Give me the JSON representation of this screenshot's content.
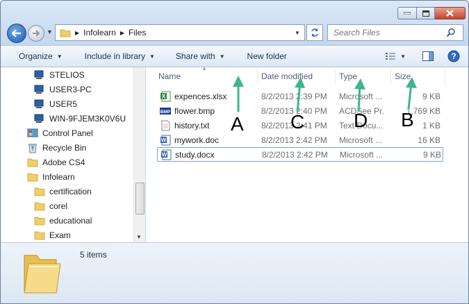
{
  "address": {
    "crumbs": [
      "Infolearn",
      "Files"
    ]
  },
  "search": {
    "placeholder": "Search Files"
  },
  "toolbar": {
    "organize": "Organize",
    "include_in_library": "Include in library",
    "share_with": "Share with",
    "new_folder": "New folder"
  },
  "sidebar": {
    "items": [
      {
        "label": "STELIOS",
        "icon": "computer-icon"
      },
      {
        "label": "USER3-PC",
        "icon": "computer-icon"
      },
      {
        "label": "USER5",
        "icon": "computer-icon"
      },
      {
        "label": "WIN-9FJEM3K0V6U",
        "icon": "computer-icon"
      },
      {
        "label": "Control Panel",
        "icon": "control-panel-icon"
      },
      {
        "label": "Recycle Bin",
        "icon": "recycle-bin-icon"
      },
      {
        "label": "Adobe CS4",
        "icon": "folder-icon"
      },
      {
        "label": "Infolearn",
        "icon": "folder-icon"
      },
      {
        "label": "certification",
        "icon": "folder-icon"
      },
      {
        "label": "corel",
        "icon": "folder-icon"
      },
      {
        "label": "educational",
        "icon": "folder-icon"
      },
      {
        "label": "Exam",
        "icon": "folder-icon"
      }
    ]
  },
  "columns": {
    "name": "Name",
    "date": "Date modified",
    "type": "Type",
    "size": "Size"
  },
  "files": [
    {
      "name": "expences.xlsx",
      "date": "8/2/2013 2:39 PM",
      "type": "Microsoft ...",
      "size": "9 KB",
      "icon": "excel-icon"
    },
    {
      "name": "flower.bmp",
      "date": "8/2/2013 2:40 PM",
      "type": "ACDSee Pr...",
      "size": "1,769 KB",
      "icon": "bmp-icon"
    },
    {
      "name": "history.txt",
      "date": "8/2/2013 2:41 PM",
      "type": "Text Docu...",
      "size": "1 KB",
      "icon": "text-file-icon"
    },
    {
      "name": "mywork.doc",
      "date": "8/2/2013 2:42 PM",
      "type": "Microsoft ...",
      "size": "16 KB",
      "icon": "word-icon"
    },
    {
      "name": "study.docx",
      "date": "8/2/2013 2:42 PM",
      "type": "Microsoft ...",
      "size": "9 KB",
      "icon": "word-icon"
    }
  ],
  "annotations": {
    "a": "A",
    "b": "B",
    "c": "C",
    "d": "D"
  },
  "details": {
    "count": "5 items"
  },
  "colors": {
    "arrow": "#3fb58a",
    "selection": "#7da2ce"
  }
}
